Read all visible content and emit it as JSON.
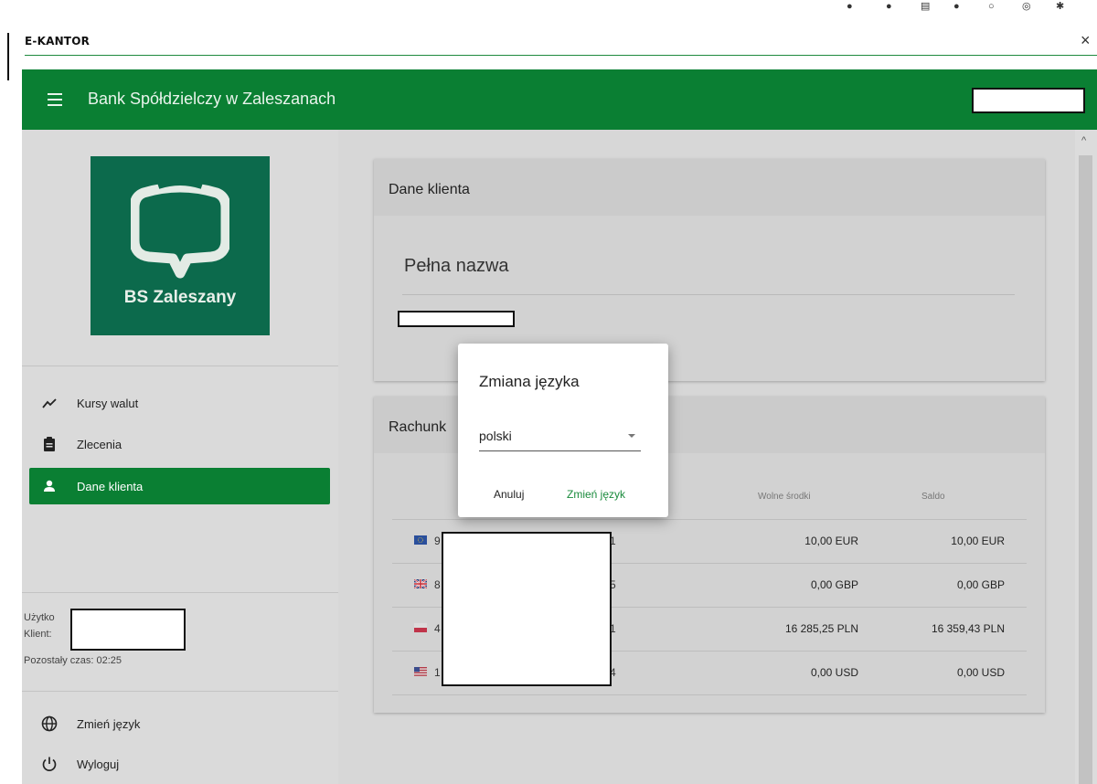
{
  "window": {
    "title": "E-KANTOR",
    "close_glyph": "×"
  },
  "appbar": {
    "title": "Bank Spółdzielczy w Zaleszanach",
    "menu_icon": "hamburger-menu-icon"
  },
  "sidebar": {
    "logo_text": "BS Zaleszany",
    "nav": [
      {
        "label": "Kursy walut",
        "icon": "trending-up-icon"
      },
      {
        "label": "Zlecenia",
        "icon": "clipboard-icon"
      },
      {
        "label": "Dane klienta",
        "icon": "person-icon",
        "active": true
      }
    ],
    "user_label": "Użytko",
    "client_label": "Klient:",
    "session": "Pozostały czas: 02:25",
    "bottom": [
      {
        "label": "Zmień język",
        "icon": "globe-icon"
      },
      {
        "label": "Wyloguj",
        "icon": "power-icon"
      }
    ]
  },
  "client_card": {
    "title": "Dane klienta",
    "full_name_label": "Pełna nazwa"
  },
  "accounts_card": {
    "title": "Rachunk",
    "headers": {
      "free": "Wolne środki",
      "balance": "Saldo"
    },
    "rows": [
      {
        "flag": "eu-flag-icon",
        "prefix": "9",
        "suffix": "1",
        "free": "10,00 EUR",
        "balance": "10,00 EUR"
      },
      {
        "flag": "uk-flag-icon",
        "prefix": "8",
        "suffix": "5",
        "free": "0,00 GBP",
        "balance": "0,00 GBP"
      },
      {
        "flag": "pl-flag-icon",
        "prefix": "4",
        "suffix": "1",
        "free": "16 285,25 PLN",
        "balance": "16 359,43 PLN"
      },
      {
        "flag": "us-flag-icon",
        "prefix": "1",
        "suffix": "4",
        "free": "0,00 USD",
        "balance": "0,00 USD"
      }
    ]
  },
  "dialog": {
    "title": "Zmiana języka",
    "selected": "polski",
    "cancel": "Anuluj",
    "confirm": "Zmień język"
  },
  "colors": {
    "brand": "#0a7f33",
    "accent_text": "#1a8b3c",
    "logo_bg": "#0c6a4c"
  }
}
